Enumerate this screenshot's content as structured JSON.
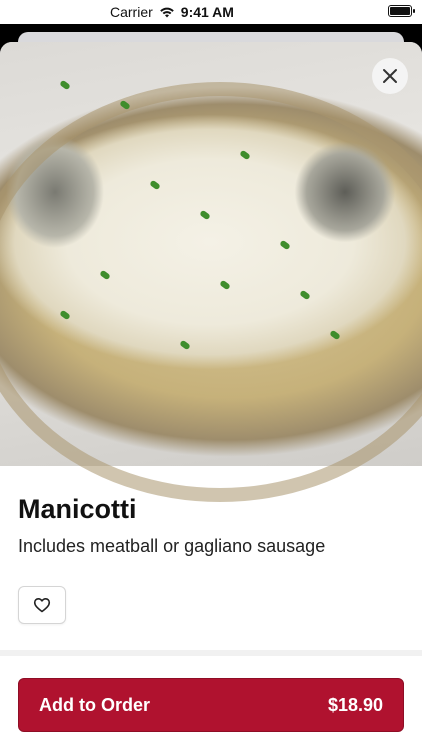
{
  "status_bar": {
    "carrier": "Carrier",
    "time": "9:41 AM"
  },
  "item": {
    "name": "Manicotti",
    "description": "Includes meatball or gagliano sausage"
  },
  "footer": {
    "add_label": "Add to Order",
    "price": "$18.90"
  },
  "colors": {
    "accent": "#b0122f"
  },
  "icons": {
    "close": "close-icon",
    "favorite": "heart-icon",
    "wifi": "wifi-icon",
    "battery": "battery-icon"
  }
}
